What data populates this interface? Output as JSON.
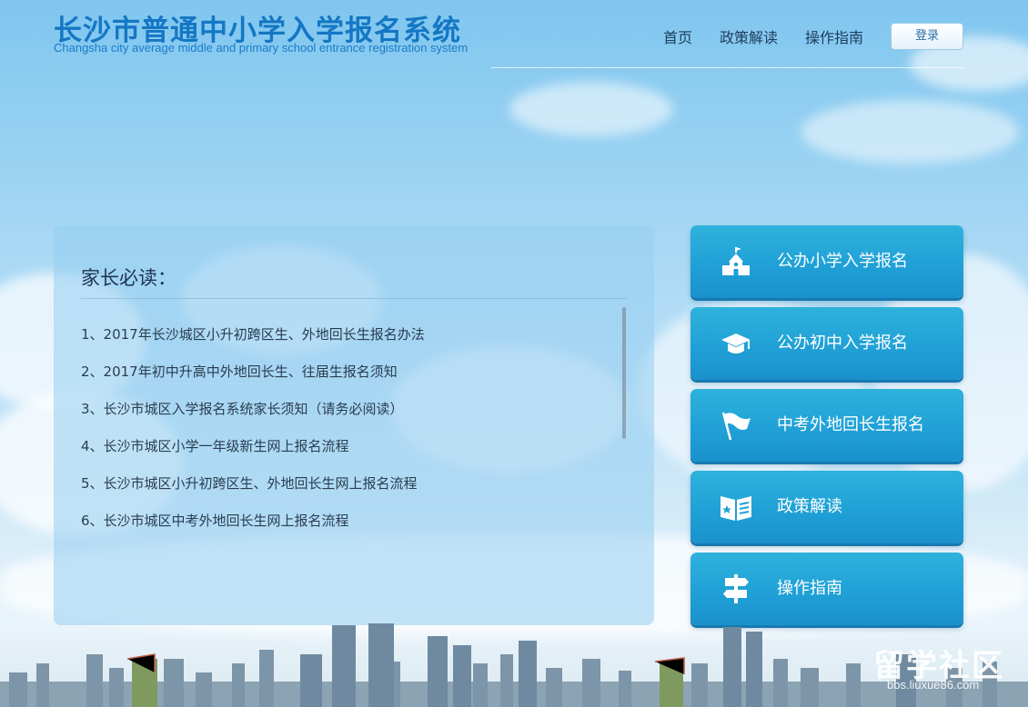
{
  "header": {
    "title_cn": "长沙市普通中小学入学报名系统",
    "title_en": "Changsha city average middle and primary school entrance registration system",
    "nav": [
      "首页",
      "政策解读",
      "操作指南"
    ],
    "login_label": "登录"
  },
  "notice": {
    "title": "家长必读：",
    "items": [
      "1、2017年长沙城区小升初跨区生、外地回长生报名办法",
      "2、2017年初中升高中外地回长生、往届生报名须知",
      "3、长沙市城区入学报名系统家长须知（请务必阅读）",
      "4、长沙市城区小学一年级新生网上报名流程",
      "5、长沙市城区小升初跨区生、外地回长生网上报名流程",
      "6、长沙市城区中考外地回长生网上报名流程"
    ]
  },
  "actions": [
    {
      "label": "公办小学入学报名",
      "icon": "school-building-icon"
    },
    {
      "label": "公办初中入学报名",
      "icon": "graduation-cap-icon"
    },
    {
      "label": "中考外地回长生报名",
      "icon": "flag-icon"
    },
    {
      "label": "政策解读",
      "icon": "open-book-icon"
    },
    {
      "label": "操作指南",
      "icon": "signpost-icon"
    }
  ],
  "watermark": {
    "text": "留学社区",
    "sub": "bbs.liuxue86.com"
  },
  "colors": {
    "title": "#1477c4",
    "button": "#1f9fd6",
    "nav_text": "#1d3d5c"
  }
}
